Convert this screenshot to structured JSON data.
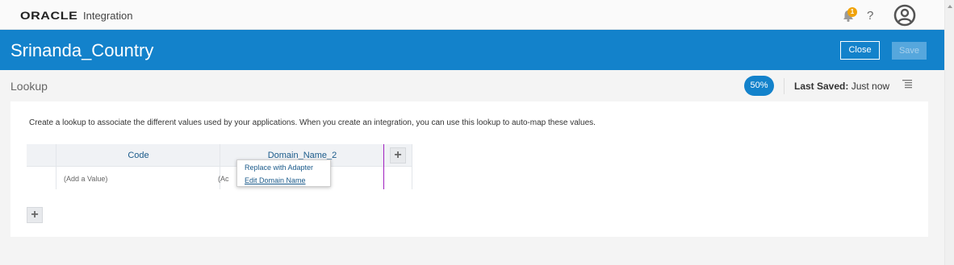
{
  "topbar": {
    "brand": "ORACLE",
    "product": "Integration",
    "notification_count": "1",
    "help_label": "?"
  },
  "header": {
    "title": "Srinanda_Country",
    "close_label": "Close",
    "save_label": "Save"
  },
  "subbar": {
    "title": "Lookup",
    "progress": "50%",
    "last_saved_label": "Last Saved:",
    "last_saved_value": "Just now"
  },
  "content": {
    "description": "Create a lookup to associate the different values used by your applications. When you create an integration, you can use this lookup to auto-map these values.",
    "columns": [
      "Code",
      "Domain_Name_2"
    ],
    "row_placeholders": [
      "(Add a Value)",
      "(Ac"
    ],
    "add_column_label": "+",
    "add_row_label": "+"
  },
  "context_menu": {
    "items": [
      "Replace with Adapter",
      "Edit Domain Name"
    ]
  },
  "colors": {
    "accent": "#1382cb",
    "badge": "#f0a30a",
    "link": "#1a5a8a"
  }
}
